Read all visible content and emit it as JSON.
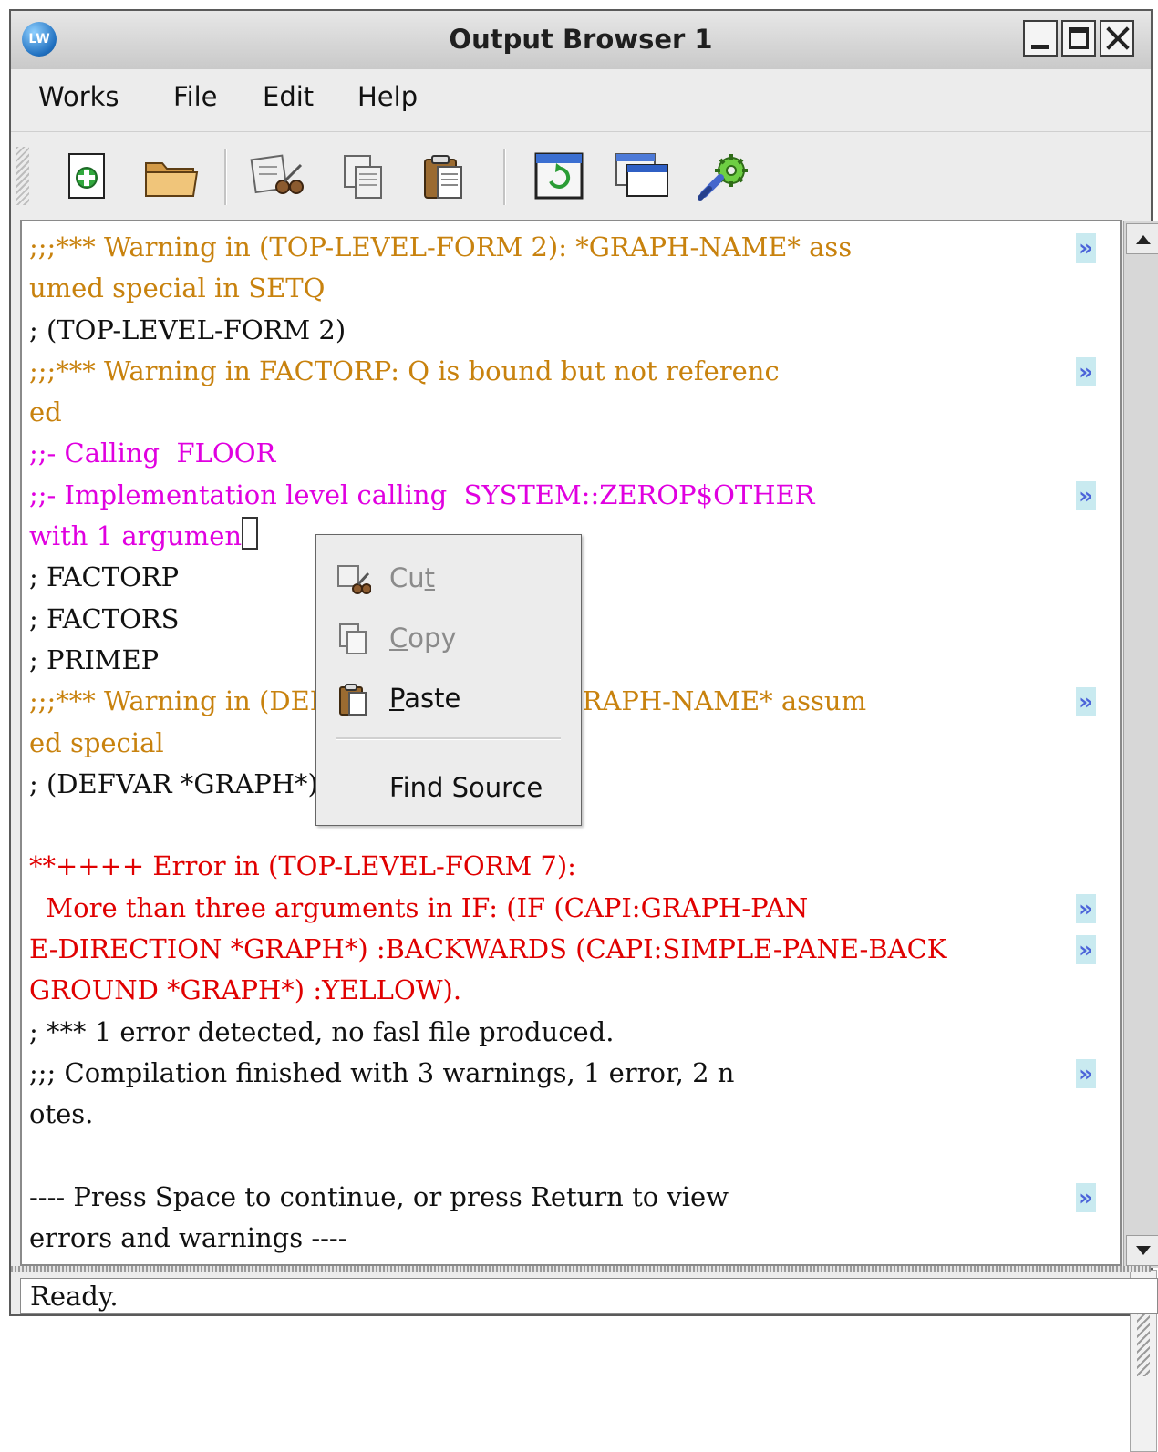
{
  "window": {
    "app_icon": "LW",
    "title": "Output Browser 1",
    "controls": [
      "minimize",
      "maximize",
      "close"
    ]
  },
  "menubar": {
    "items": [
      {
        "label": "Works"
      },
      {
        "label": "File"
      },
      {
        "label": "Edit"
      },
      {
        "label": "Help"
      }
    ]
  },
  "toolbar": {
    "icons": [
      "new-icon",
      "open-folder-icon",
      "cut-icon",
      "copy-icon",
      "paste-icon",
      "refresh-icon",
      "window-icon",
      "tools-icon"
    ]
  },
  "output": {
    "lines": [
      {
        "text": ";;;*** Warning in (TOP-LEVEL-FORM 2): *GRAPH-NAME* ass",
        "color": "#c8820e",
        "more": "»"
      },
      {
        "text": "umed special in SETQ",
        "color": "#c8820e"
      },
      {
        "text": "; (TOP-LEVEL-FORM 2)",
        "color": "#111111"
      },
      {
        "text": ";;;*** Warning in FACTORP: Q is bound but not referenc",
        "color": "#c8820e",
        "more": "»"
      },
      {
        "text": "ed",
        "color": "#c8820e"
      },
      {
        "text": ";;- Calling  FLOOR",
        "color": "#e000e0"
      },
      {
        "text": ";;- Implementation level calling  SYSTEM::ZEROP$OTHER ",
        "color": "#e000e0",
        "more": "»"
      },
      {
        "text": "with 1 argumen",
        "color": "#e000e0",
        "cursor": true
      },
      {
        "text": "; FACTORP",
        "color": "#111111"
      },
      {
        "text": "; FACTORS",
        "color": "#111111"
      },
      {
        "text": "; PRIMEP",
        "color": "#111111"
      },
      {
        "text": ";;;*** Warning in (DEFVAR *GRAPH*): *GRAPH-NAME* assum",
        "color": "#c8820e",
        "more": "»"
      },
      {
        "text": "ed special",
        "color": "#c8820e"
      },
      {
        "text": "; (DEFVAR *GRAPH*)",
        "color": "#111111"
      },
      {
        "text": "",
        "color": "#111111"
      },
      {
        "text": "**++++ Error in (TOP-LEVEL-FORM 7):",
        "color": "#e00000"
      },
      {
        "text": "  More than three arguments in IF: (IF (CAPI:GRAPH-PAN",
        "color": "#e00000",
        "more": "»"
      },
      {
        "text": "E-DIRECTION *GRAPH*) :BACKWARDS (CAPI:SIMPLE-PANE-BACK",
        "color": "#e00000",
        "more": "»"
      },
      {
        "text": "GROUND *GRAPH*) :YELLOW).",
        "color": "#e00000"
      },
      {
        "text": "; *** 1 error detected, no fasl file produced.",
        "color": "#111111"
      },
      {
        "text": ";;; Compilation finished with 3 warnings, 1 error, 2 n",
        "color": "#111111",
        "more": "»"
      },
      {
        "text": "otes.",
        "color": "#111111"
      },
      {
        "text": "",
        "color": "#111111"
      },
      {
        "text": "---- Press Space to continue, or press Return to view ",
        "color": "#111111",
        "more": "»"
      },
      {
        "text": "errors and warnings ----",
        "color": "#111111"
      }
    ]
  },
  "context_menu": {
    "items": [
      {
        "label": "Cut",
        "enabled": false,
        "mnemonic_index": 2,
        "icon": "cut-icon"
      },
      {
        "label": "Copy",
        "enabled": false,
        "mnemonic_index": 0,
        "icon": "copy-icon"
      },
      {
        "label": "Paste",
        "enabled": true,
        "mnemonic_index": 0,
        "icon": "paste-icon"
      },
      {
        "label": "Find Source",
        "enabled": true,
        "mnemonic_index": -1,
        "icon": ""
      }
    ]
  },
  "statusbar": {
    "text": "Ready."
  }
}
